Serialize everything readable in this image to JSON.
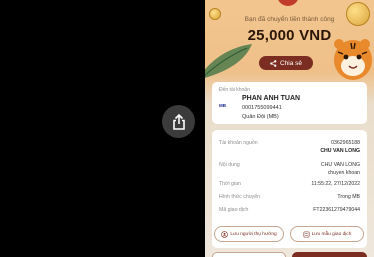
{
  "overlay": {
    "share_icon": "share-icon"
  },
  "header": {
    "success_message": "Bạn đã chuyển tiền thành công",
    "amount": "25,000 VND",
    "share_label": "Chia sẻ",
    "accent_color": "#7b2d21"
  },
  "recipient": {
    "to_label": "Đến tài khoản",
    "bank_logo": "MB",
    "name": "PHAN ANH TUAN",
    "account_number": "0001755099441",
    "bank_name": "Quân Đội (MB)"
  },
  "details": {
    "source_label": "Tài khoản nguồn",
    "source_account": "0362965188",
    "source_name": "CHU VAN LONG",
    "content_label": "Nội dung",
    "content_line1": "CHU VAN LONG",
    "content_line2": "chuyen khoan",
    "time_label": "Thời gian",
    "time_value": "11:55:22, 27/12/2022",
    "method_label": "Hình thức chuyển",
    "method_value": "Trong MB",
    "code_label": "Mã giao dịch",
    "code_value": "FT22361279479044"
  },
  "actions": {
    "save_recipient": "Lưu người thụ hưởng",
    "save_template": "Lưu mẫu giao dịch"
  }
}
